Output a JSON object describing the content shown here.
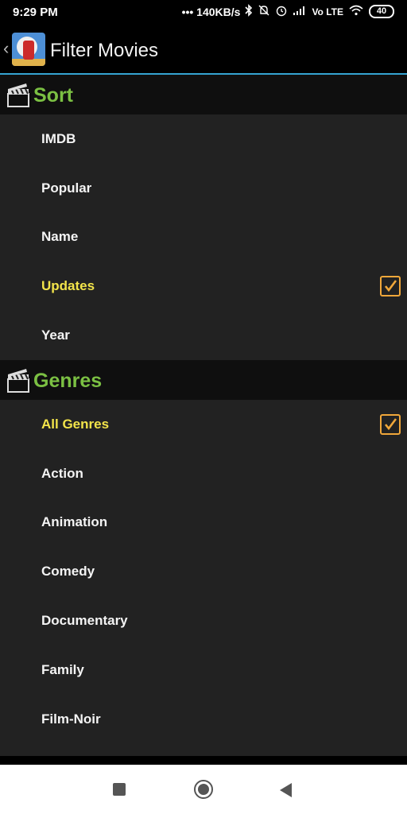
{
  "status_bar": {
    "time": "9:29 PM",
    "speed": "••• 140KB/s",
    "volte": "Vo LTE",
    "battery": "40"
  },
  "action_bar": {
    "title": "Filter Movies"
  },
  "sort_section": {
    "title": "Sort",
    "items": [
      {
        "label": "IMDB",
        "selected": false
      },
      {
        "label": "Popular",
        "selected": false
      },
      {
        "label": "Name",
        "selected": false
      },
      {
        "label": "Updates",
        "selected": true
      },
      {
        "label": "Year",
        "selected": false
      }
    ]
  },
  "genres_section": {
    "title": "Genres",
    "items": [
      {
        "label": "All Genres",
        "selected": true
      },
      {
        "label": "Action",
        "selected": false
      },
      {
        "label": "Animation",
        "selected": false
      },
      {
        "label": "Comedy",
        "selected": false
      },
      {
        "label": "Documentary",
        "selected": false
      },
      {
        "label": "Family",
        "selected": false
      },
      {
        "label": "Film-Noir",
        "selected": false
      }
    ]
  },
  "colors": {
    "accent": "#35a4d2",
    "section_title": "#7bc043",
    "selected_text": "#f2e44a",
    "checkbox": "#f0a73a"
  }
}
